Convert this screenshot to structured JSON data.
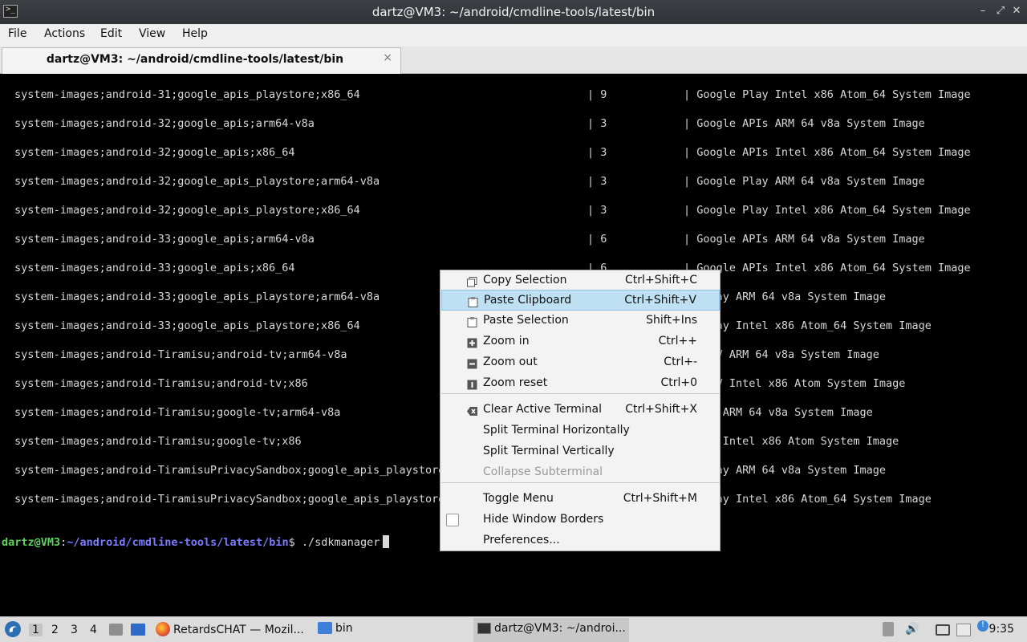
{
  "window": {
    "title": "dartz@VM3: ~/android/cmdline-tools/latest/bin",
    "app_icon": ">_"
  },
  "menubar": [
    "File",
    "Actions",
    "Edit",
    "View",
    "Help"
  ],
  "tab": {
    "label": "dartz@VM3: ~/android/cmdline-tools/latest/bin",
    "close": "×"
  },
  "terminal": {
    "rows": [
      {
        "path": "system-images;android-31;google_apis_playstore;x86_64",
        "version": "| 9",
        "desc": "| Google Play Intel x86 Atom_64 System Image"
      },
      {
        "path": "system-images;android-32;google_apis;arm64-v8a",
        "version": "| 3",
        "desc": "| Google APIs ARM 64 v8a System Image"
      },
      {
        "path": "system-images;android-32;google_apis;x86_64",
        "version": "| 3",
        "desc": "| Google APIs Intel x86 Atom_64 System Image"
      },
      {
        "path": "system-images;android-32;google_apis_playstore;arm64-v8a",
        "version": "| 3",
        "desc": "| Google Play ARM 64 v8a System Image"
      },
      {
        "path": "system-images;android-32;google_apis_playstore;x86_64",
        "version": "| 3",
        "desc": "| Google Play Intel x86 Atom_64 System Image"
      },
      {
        "path": "system-images;android-33;google_apis;arm64-v8a",
        "version": "| 6",
        "desc": "| Google APIs ARM 64 v8a System Image"
      },
      {
        "path": "system-images;android-33;google_apis;x86_64",
        "version": "| 6",
        "desc": "| Google APIs Intel x86 Atom_64 System Image"
      },
      {
        "path": "system-images;android-33;google_apis_playstore;arm64-v8a",
        "version": "",
        "desc": "le Play ARM 64 v8a System Image"
      },
      {
        "path": "system-images;android-33;google_apis_playstore;x86_64",
        "version": "",
        "desc": "le Play Intel x86 Atom_64 System Image"
      },
      {
        "path": "system-images;android-Tiramisu;android-tv;arm64-v8a",
        "version": "",
        "desc": "oid TV ARM 64 v8a System Image"
      },
      {
        "path": "system-images;android-Tiramisu;android-tv;x86",
        "version": "",
        "desc": "oid TV Intel x86 Atom System Image"
      },
      {
        "path": "system-images;android-Tiramisu;google-tv;arm64-v8a",
        "version": "",
        "desc": "le TV ARM 64 v8a System Image"
      },
      {
        "path": "system-images;android-Tiramisu;google-tv;x86",
        "version": "",
        "desc": "le TV Intel x86 Atom System Image"
      },
      {
        "path": "system-images;android-TiramisuPrivacySandbox;google_apis_playstore",
        "version": "",
        "desc": "le Play ARM 64 v8a System Image"
      },
      {
        "path": "system-images;android-TiramisuPrivacySandbox;google_apis_playstore",
        "version": "",
        "desc": "le Play Intel x86 Atom_64 System Image"
      }
    ],
    "prompt": {
      "user_host": "dartz@VM3",
      "sep": ":",
      "path": "~/android/cmdline-tools/latest/bin",
      "symbol": "$ ",
      "command": "./sdkmanager"
    }
  },
  "context_menu": {
    "items": [
      {
        "label": "Copy Selection",
        "shortcut": "Ctrl+Shift+C",
        "icon": "copy-icon"
      },
      {
        "label": "Paste Clipboard",
        "shortcut": "Ctrl+Shift+V",
        "icon": "paste-icon",
        "highlighted": true
      },
      {
        "label": "Paste Selection",
        "shortcut": "Shift+Ins",
        "icon": "paste-icon"
      },
      {
        "label": "Zoom in",
        "shortcut": "Ctrl++",
        "icon": "zoom-in-icon"
      },
      {
        "label": "Zoom out",
        "shortcut": "Ctrl+-",
        "icon": "zoom-out-icon"
      },
      {
        "label": "Zoom reset",
        "shortcut": "Ctrl+0",
        "icon": "zoom-reset-icon"
      },
      {
        "label": "Clear Active Terminal",
        "shortcut": "Ctrl+Shift+X",
        "icon": "clear-icon"
      },
      {
        "label": "Split Terminal Horizontally",
        "shortcut": ""
      },
      {
        "label": "Split Terminal Vertically",
        "shortcut": ""
      },
      {
        "label": "Collapse Subterminal",
        "shortcut": "",
        "disabled": true
      },
      {
        "label": "Toggle Menu",
        "shortcut": "Ctrl+Shift+M"
      },
      {
        "label": "Hide Window Borders",
        "shortcut": "",
        "checkbox": false
      },
      {
        "label": "Preferences...",
        "shortcut": ""
      }
    ]
  },
  "taskbar": {
    "workspaces": [
      "1",
      "2",
      "3",
      "4"
    ],
    "tasks": [
      {
        "label": "RetardsCHAT — Mozil...",
        "icon": "firefox-icon"
      },
      {
        "label": "bin",
        "icon": "folder-icon"
      },
      {
        "label": "dartz@VM3: ~/androi...",
        "icon": "terminal-icon",
        "active": true
      }
    ],
    "clock": "9:35"
  },
  "colors": {
    "prompt_user": "#5ed35e",
    "prompt_path": "#7b7bff",
    "menu_highlight": "#bfe0f3"
  }
}
